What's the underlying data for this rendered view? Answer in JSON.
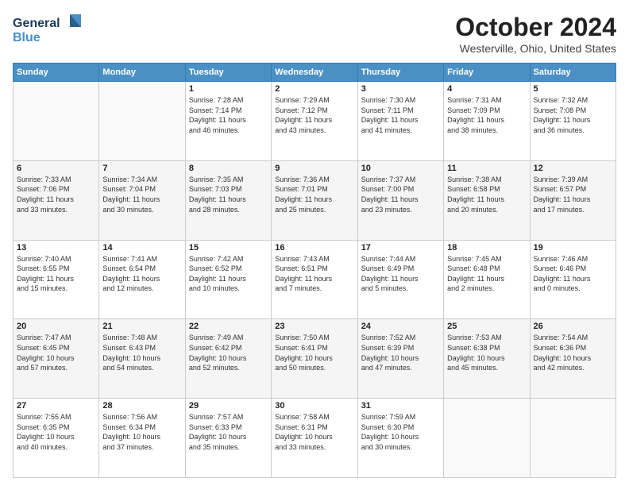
{
  "logo": {
    "line1": "General",
    "line2": "Blue"
  },
  "title": "October 2024",
  "location": "Westerville, Ohio, United States",
  "headers": [
    "Sunday",
    "Monday",
    "Tuesday",
    "Wednesday",
    "Thursday",
    "Friday",
    "Saturday"
  ],
  "weeks": [
    [
      {
        "day": "",
        "info": ""
      },
      {
        "day": "",
        "info": ""
      },
      {
        "day": "1",
        "info": "Sunrise: 7:28 AM\nSunset: 7:14 PM\nDaylight: 11 hours\nand 46 minutes."
      },
      {
        "day": "2",
        "info": "Sunrise: 7:29 AM\nSunset: 7:12 PM\nDaylight: 11 hours\nand 43 minutes."
      },
      {
        "day": "3",
        "info": "Sunrise: 7:30 AM\nSunset: 7:11 PM\nDaylight: 11 hours\nand 41 minutes."
      },
      {
        "day": "4",
        "info": "Sunrise: 7:31 AM\nSunset: 7:09 PM\nDaylight: 11 hours\nand 38 minutes."
      },
      {
        "day": "5",
        "info": "Sunrise: 7:32 AM\nSunset: 7:08 PM\nDaylight: 11 hours\nand 36 minutes."
      }
    ],
    [
      {
        "day": "6",
        "info": "Sunrise: 7:33 AM\nSunset: 7:06 PM\nDaylight: 11 hours\nand 33 minutes."
      },
      {
        "day": "7",
        "info": "Sunrise: 7:34 AM\nSunset: 7:04 PM\nDaylight: 11 hours\nand 30 minutes."
      },
      {
        "day": "8",
        "info": "Sunrise: 7:35 AM\nSunset: 7:03 PM\nDaylight: 11 hours\nand 28 minutes."
      },
      {
        "day": "9",
        "info": "Sunrise: 7:36 AM\nSunset: 7:01 PM\nDaylight: 11 hours\nand 25 minutes."
      },
      {
        "day": "10",
        "info": "Sunrise: 7:37 AM\nSunset: 7:00 PM\nDaylight: 11 hours\nand 23 minutes."
      },
      {
        "day": "11",
        "info": "Sunrise: 7:38 AM\nSunset: 6:58 PM\nDaylight: 11 hours\nand 20 minutes."
      },
      {
        "day": "12",
        "info": "Sunrise: 7:39 AM\nSunset: 6:57 PM\nDaylight: 11 hours\nand 17 minutes."
      }
    ],
    [
      {
        "day": "13",
        "info": "Sunrise: 7:40 AM\nSunset: 6:55 PM\nDaylight: 11 hours\nand 15 minutes."
      },
      {
        "day": "14",
        "info": "Sunrise: 7:41 AM\nSunset: 6:54 PM\nDaylight: 11 hours\nand 12 minutes."
      },
      {
        "day": "15",
        "info": "Sunrise: 7:42 AM\nSunset: 6:52 PM\nDaylight: 11 hours\nand 10 minutes."
      },
      {
        "day": "16",
        "info": "Sunrise: 7:43 AM\nSunset: 6:51 PM\nDaylight: 11 hours\nand 7 minutes."
      },
      {
        "day": "17",
        "info": "Sunrise: 7:44 AM\nSunset: 6:49 PM\nDaylight: 11 hours\nand 5 minutes."
      },
      {
        "day": "18",
        "info": "Sunrise: 7:45 AM\nSunset: 6:48 PM\nDaylight: 11 hours\nand 2 minutes."
      },
      {
        "day": "19",
        "info": "Sunrise: 7:46 AM\nSunset: 6:46 PM\nDaylight: 11 hours\nand 0 minutes."
      }
    ],
    [
      {
        "day": "20",
        "info": "Sunrise: 7:47 AM\nSunset: 6:45 PM\nDaylight: 10 hours\nand 57 minutes."
      },
      {
        "day": "21",
        "info": "Sunrise: 7:48 AM\nSunset: 6:43 PM\nDaylight: 10 hours\nand 54 minutes."
      },
      {
        "day": "22",
        "info": "Sunrise: 7:49 AM\nSunset: 6:42 PM\nDaylight: 10 hours\nand 52 minutes."
      },
      {
        "day": "23",
        "info": "Sunrise: 7:50 AM\nSunset: 6:41 PM\nDaylight: 10 hours\nand 50 minutes."
      },
      {
        "day": "24",
        "info": "Sunrise: 7:52 AM\nSunset: 6:39 PM\nDaylight: 10 hours\nand 47 minutes."
      },
      {
        "day": "25",
        "info": "Sunrise: 7:53 AM\nSunset: 6:38 PM\nDaylight: 10 hours\nand 45 minutes."
      },
      {
        "day": "26",
        "info": "Sunrise: 7:54 AM\nSunset: 6:36 PM\nDaylight: 10 hours\nand 42 minutes."
      }
    ],
    [
      {
        "day": "27",
        "info": "Sunrise: 7:55 AM\nSunset: 6:35 PM\nDaylight: 10 hours\nand 40 minutes."
      },
      {
        "day": "28",
        "info": "Sunrise: 7:56 AM\nSunset: 6:34 PM\nDaylight: 10 hours\nand 37 minutes."
      },
      {
        "day": "29",
        "info": "Sunrise: 7:57 AM\nSunset: 6:33 PM\nDaylight: 10 hours\nand 35 minutes."
      },
      {
        "day": "30",
        "info": "Sunrise: 7:58 AM\nSunset: 6:31 PM\nDaylight: 10 hours\nand 33 minutes."
      },
      {
        "day": "31",
        "info": "Sunrise: 7:59 AM\nSunset: 6:30 PM\nDaylight: 10 hours\nand 30 minutes."
      },
      {
        "day": "",
        "info": ""
      },
      {
        "day": "",
        "info": ""
      }
    ]
  ]
}
